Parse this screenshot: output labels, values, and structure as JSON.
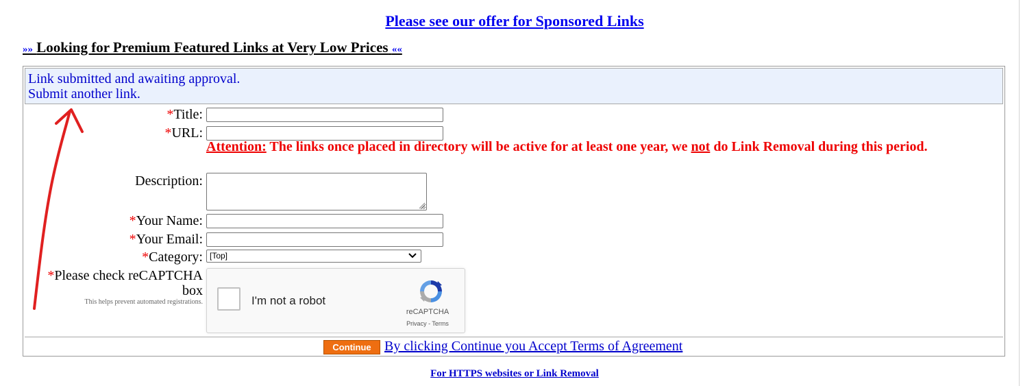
{
  "header": {
    "offer_link": "Please see our offer for Sponsored Links",
    "premium_prefix": "»»",
    "premium_text": "Looking for Premium Featured Links at Very Low Prices",
    "premium_suffix": "««"
  },
  "notice": {
    "line1": "Link submitted and awaiting approval.",
    "line2": "Submit another link."
  },
  "form": {
    "required_mark": "*",
    "title_label": "Title:",
    "title_value": "",
    "url_label": "URL:",
    "url_value": "",
    "attention_heading": "Attention:",
    "attention_text_1": "The links once placed in directory will be active for at least one year, we",
    "attention_not": "not",
    "attention_text_2": "do Link Removal during this period.",
    "description_label": "Description:",
    "description_value": "",
    "name_label": "Your Name:",
    "name_value": "",
    "email_label": "Your Email:",
    "email_value": "",
    "category_label": "Category:",
    "category_selected": "[Top]",
    "captcha_label": "Please check reCAPTCHA box",
    "captcha_help": "This helps prevent automated registrations."
  },
  "captcha": {
    "checkbox_text": "I'm not a robot",
    "brand": "reCAPTCHA",
    "privacy": "Privacy",
    "separator": " - ",
    "terms": "Terms",
    "checked": false
  },
  "actions": {
    "continue_label": "Continue",
    "terms_link": "By clicking Continue you Accept Terms of Agreement"
  },
  "footer": {
    "link": "For HTTPS websites or Link Removal"
  },
  "colors": {
    "link": "#0000ee",
    "required": "#ee0000",
    "notice_bg": "#eaf1fd",
    "continue_bg": "#ee6e11",
    "annotation": "#e02020"
  },
  "icons": {
    "select_chevron": "chevron-down-icon",
    "captcha_logo": "recaptcha-logo-icon",
    "resize_grip": "resize-grip-icon",
    "annotation": "red-arrow-annotation"
  }
}
